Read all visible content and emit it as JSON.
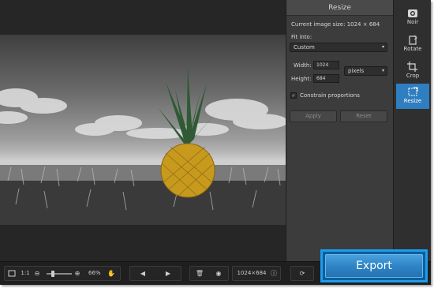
{
  "panel": {
    "title": "Resize",
    "current_size_label": "Current image size: 1024 × 684",
    "fit_into_label": "Fit into:",
    "fit_into_value": "Custom",
    "width_label": "Width:",
    "width_value": "1024",
    "height_label": "Height:",
    "height_value": "684",
    "unit_value": "pixels",
    "constrain_label": "Constrain proportions",
    "constrain_checked": "✓",
    "apply_label": "Apply",
    "reset_label": "Reset"
  },
  "tools": [
    {
      "label": "Noir",
      "icon": "noir-icon"
    },
    {
      "label": "Rotate",
      "icon": "rotate-icon"
    },
    {
      "label": "Crop",
      "icon": "crop-icon"
    },
    {
      "label": "Resize",
      "icon": "resize-icon",
      "active": true
    }
  ],
  "bottombar": {
    "ratio_label": "1:1",
    "zoom_value": "66%",
    "dimensions": "1024×684",
    "slider_level": 0.2
  },
  "export_label": "Export",
  "colors": {
    "accent": "#2f7ebf",
    "export_border": "#1d9cf0"
  }
}
